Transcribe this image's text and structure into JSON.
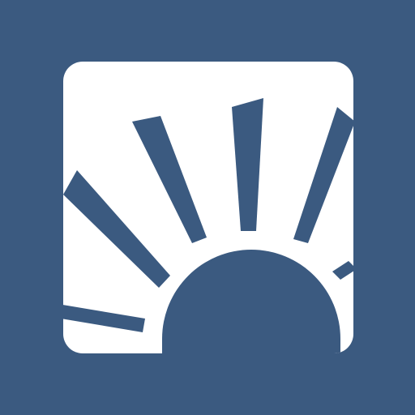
{
  "app_icon": {
    "name": "sunrise-icon",
    "colors": {
      "background": "#3b5a80",
      "tile": "#ffffff"
    }
  }
}
